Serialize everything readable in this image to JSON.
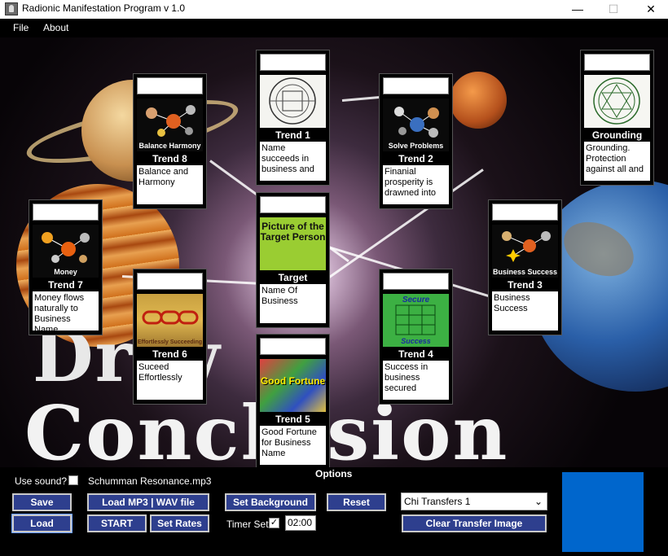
{
  "window": {
    "title": "Radionic Manifestation Program v 1.0",
    "minimize": "—",
    "maximize": "☐",
    "close": "✕"
  },
  "menu": {
    "file": "File",
    "about": "About"
  },
  "background": {
    "line1": "Dr w",
    "line2": "Conclusion"
  },
  "cards": {
    "trend1": {
      "label": "Trend 1",
      "desc": "Name succeeds in business and",
      "caption": ""
    },
    "trend2": {
      "label": "Trend 2",
      "desc": "Finanial prosperity is drawned into",
      "caption": "Solve Problems"
    },
    "trend3": {
      "label": "Trend 3",
      "desc": "Business Success",
      "caption": "Business Success"
    },
    "trend4": {
      "label": "Trend 4",
      "desc": "Success in business secured",
      "caption_top": "Secure",
      "caption": "Success"
    },
    "trend5": {
      "label": "Trend 5",
      "desc": "Good Fortune for Business Name",
      "caption": "Good Fortune"
    },
    "trend6": {
      "label": "Trend 6",
      "desc": "Suceed Effortlessly",
      "caption": "Effortlessly Succeeding"
    },
    "trend7": {
      "label": "Trend 7",
      "desc": "Money flows naturally to Business Name",
      "caption": "Money"
    },
    "trend8": {
      "label": "Trend 8",
      "desc": "Balance and Harmony",
      "caption": "Balance Harmony"
    },
    "target": {
      "label": "Target",
      "desc": "Name Of Business",
      "image_text": "Picture of the Target Person"
    },
    "grounding": {
      "label": "Grounding",
      "desc": "Grounding. Protection against all and"
    }
  },
  "options": {
    "title": "Options",
    "use_sound_label": "Use sound?",
    "use_sound_checked": false,
    "sound_file": "Schumman Resonance.mp3",
    "save": "Save",
    "load": "Load",
    "load_mp3": "Load MP3 | WAV file",
    "start": "START",
    "set_rates": "Set Rates",
    "set_background": "Set Background",
    "reset": "Reset",
    "timer_label": "Timer Set",
    "timer_checked": true,
    "timer_value": "02:00",
    "chi_select": "Chi Transfers 1",
    "clear_transfer": "Clear Transfer Image",
    "swatch_color": "#0066cc"
  },
  "icons": {
    "app": "app-icon",
    "check": "✓",
    "dropdown": "⌄"
  }
}
